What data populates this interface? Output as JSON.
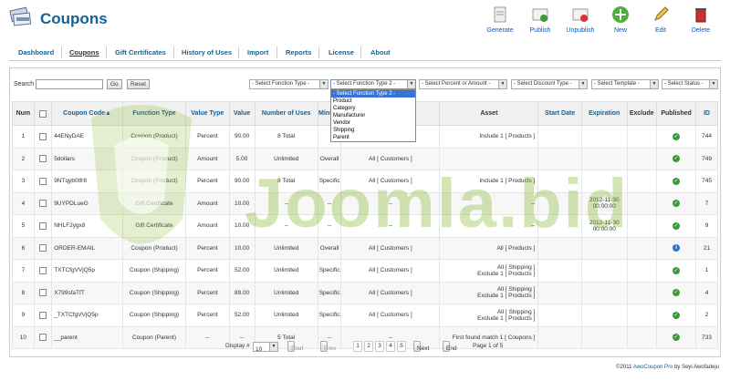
{
  "header": {
    "title": "Coupons"
  },
  "toolbar": [
    {
      "label": "Generate",
      "icon": "generate-icon"
    },
    {
      "label": "Publish",
      "icon": "publish-icon"
    },
    {
      "label": "Unpublish",
      "icon": "unpublish-icon"
    },
    {
      "label": "New",
      "icon": "new-icon"
    },
    {
      "label": "Edit",
      "icon": "edit-icon"
    },
    {
      "label": "Delete",
      "icon": "delete-icon"
    }
  ],
  "nav": [
    "Dashboard",
    "Coupons",
    "Gift Certificates",
    "History of Uses",
    "Import",
    "Reports",
    "License",
    "About"
  ],
  "filters": {
    "search_label": "Search",
    "go": "Go",
    "reset": "Reset",
    "selects": [
      "- Select Function Type -",
      "- Select Function Type 2 -",
      "- Select Percent or Amount -",
      "- Select Discount Type -",
      "- Select Template -",
      "- Select Status -"
    ],
    "dropdown_options": [
      "- Select Function Type 2 -",
      "Product",
      "Category",
      "Manufacturer",
      "Vendor",
      "Shipping",
      "Parent"
    ]
  },
  "table": {
    "headers": [
      "Num",
      "",
      "Coupon Code",
      "Function Type",
      "Value Type",
      "Value",
      "Number of Uses",
      "Mini Va",
      "Customers",
      "Asset",
      "Start Date",
      "Expiration",
      "Exclude",
      "Published",
      "ID"
    ],
    "rows": [
      [
        "1",
        "44ENyDAE",
        "Coupon (Product)",
        "Percent",
        "90.00",
        "8 Total",
        "",
        "All [ Customers ]",
        "Include 1 [ Products ]",
        "",
        "",
        "",
        "pub",
        "744"
      ],
      [
        "2",
        "5dollars",
        "Coupon (Product)",
        "Amount",
        "5.00",
        "Unlimited",
        "Overall",
        "All [ Customers ]",
        "",
        "",
        "",
        "",
        "pub",
        "749"
      ],
      [
        "3",
        "9NTqyb0tfr8",
        "Coupon (Product)",
        "Percent",
        "90.00",
        "8 Total",
        "Specific",
        "All [ Customers ]",
        "Include 1 [ Products ]",
        "",
        "",
        "",
        "pub",
        "745"
      ],
      [
        "4",
        "9UYPDLueG",
        "Gift Certificate",
        "Amount",
        "10.00",
        "--",
        "--",
        "--",
        "--",
        "",
        "2012-11-30 00:00:00",
        "",
        "pub",
        "7"
      ],
      [
        "5",
        "NHLF2ygx8",
        "Gift Certificate",
        "Amount",
        "10.00",
        "--",
        "--",
        "--",
        "--",
        "",
        "2012-11-30 00:00:00",
        "",
        "pub",
        "9"
      ],
      [
        "6",
        "ORDER-EMAIL",
        "Coupon (Product)",
        "Percent",
        "10.00",
        "Unlimited",
        "Overall",
        "All [ Customers ]",
        "All [ Products ]",
        "",
        "",
        "",
        "info",
        "21"
      ],
      [
        "7",
        "TXTCfgVVjQ5p",
        "Coupon (Shipping)",
        "Percent",
        "52.00",
        "Unlimited",
        "Specific",
        "All [ Customers ]",
        "All [ Shipping ]\nExclude 1 [ Products ]",
        "",
        "",
        "",
        "pub",
        "1"
      ],
      [
        "8",
        "X799sfaTfT",
        "Coupon (Shipping)",
        "Percent",
        "89.00",
        "Unlimited",
        "Specific",
        "All [ Customers ]",
        "All [ Shipping ]\nExclude 1 [ Products ]",
        "",
        "",
        "",
        "pub",
        "4"
      ],
      [
        "9",
        "_TXTCfgVVjQ5p",
        "Coupon (Shipping)",
        "Percent",
        "52.00",
        "Unlimited",
        "Specific",
        "All [ Customers ]",
        "All [ Shipping ]\nExclude 1 [ Products ]",
        "",
        "",
        "",
        "pub",
        "2"
      ],
      [
        "10",
        "__parent",
        "Coupon (Parent)",
        "--",
        "--",
        "5 Total",
        "--",
        "--",
        "First found match 1 [ Coupons ]",
        "",
        "",
        "",
        "pub",
        "733"
      ]
    ]
  },
  "pager": {
    "display_label": "Display #",
    "display_value": "10",
    "start": "Start",
    "prev": "Prev",
    "pages": [
      "1",
      "2",
      "3",
      "4",
      "5"
    ],
    "next": "Next",
    "end": "End",
    "page_info": "Page 1 of 5"
  },
  "footer": {
    "prefix": "©2011 ",
    "product": "AwoCoupon Pro",
    "suffix": " by Seyi Awofadeju"
  },
  "watermark": "Joomla.bid"
}
